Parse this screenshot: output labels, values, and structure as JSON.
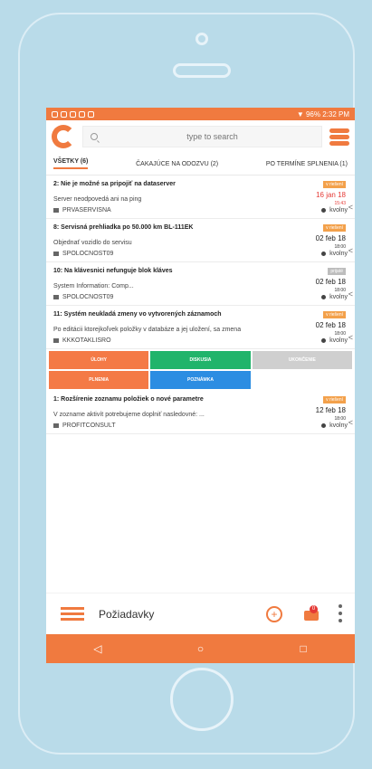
{
  "status": {
    "right": "▼ 96% 2:32 PM"
  },
  "search": {
    "placeholder": "type to search"
  },
  "tabs": [
    "VŠETKY (6)",
    "ČAKAJÚCE NA ODOZVU (2)",
    "PO TERMÍNE SPLNENIA (1)"
  ],
  "items": [
    {
      "title": "2: Nie je možné sa pripojiť na dataserver",
      "badge": "v riešení",
      "date": "16 jan 18",
      "time": "15:43",
      "desc": "Server neodpovedá ani na ping",
      "company": "PRVASERVISNA",
      "user": "kvolny",
      "highlight": true
    },
    {
      "title": "8: Servisná prehliadka po 50.000 km BL-111EK",
      "badge": "v riešení",
      "date": "02 feb 18",
      "time": "18:00",
      "desc": "Objednať vozidlo do servisu",
      "company": "SPOLOCNOST09",
      "user": "kvolny"
    },
    {
      "title": "10: Na klávesnici nefunguje blok kláves",
      "badge": "prijaté",
      "date": "02 feb 18",
      "time": "18:00",
      "desc": "System Information: Comp...",
      "company": "SPOLOCNOST09",
      "user": "kvolny"
    },
    {
      "title": "11: Systém neukladá zmeny vo vytvorených záznamoch",
      "badge": "v riešení",
      "date": "02 feb 18",
      "time": "18:00",
      "desc": "Po editácii ktorejkoľvek položky v databáze a jej uložení, sa zmena",
      "company": "KKKOTAKLISRO",
      "user": "kvolny"
    }
  ],
  "actions": [
    {
      "label": "ÚLOHY",
      "color": "#f47a46"
    },
    {
      "label": "DISKUSIA",
      "color": "#21b46b"
    },
    {
      "label": "UKONČENIE",
      "color": "#cfcfcf"
    },
    {
      "label": "PLNENIA",
      "color": "#f47a46"
    },
    {
      "label": "POZNÁMKA",
      "color": "#2c8de2"
    }
  ],
  "item5": {
    "title": "1: Rozšírenie zoznamu položiek o nové parametre",
    "badge": "v riešení",
    "date": "12 feb 18",
    "time": "18:00",
    "desc": "V zozname aktivít potrebujeme doplniť nasledovné: ...",
    "company": "PROFITCONSULT",
    "user": "kvolny"
  },
  "bottom": {
    "title": "Požiadavky",
    "add": "+",
    "mail_badge": "0",
    "more": "⋮"
  },
  "nav": {
    "back": "◁",
    "home": "○",
    "recent": "□"
  }
}
